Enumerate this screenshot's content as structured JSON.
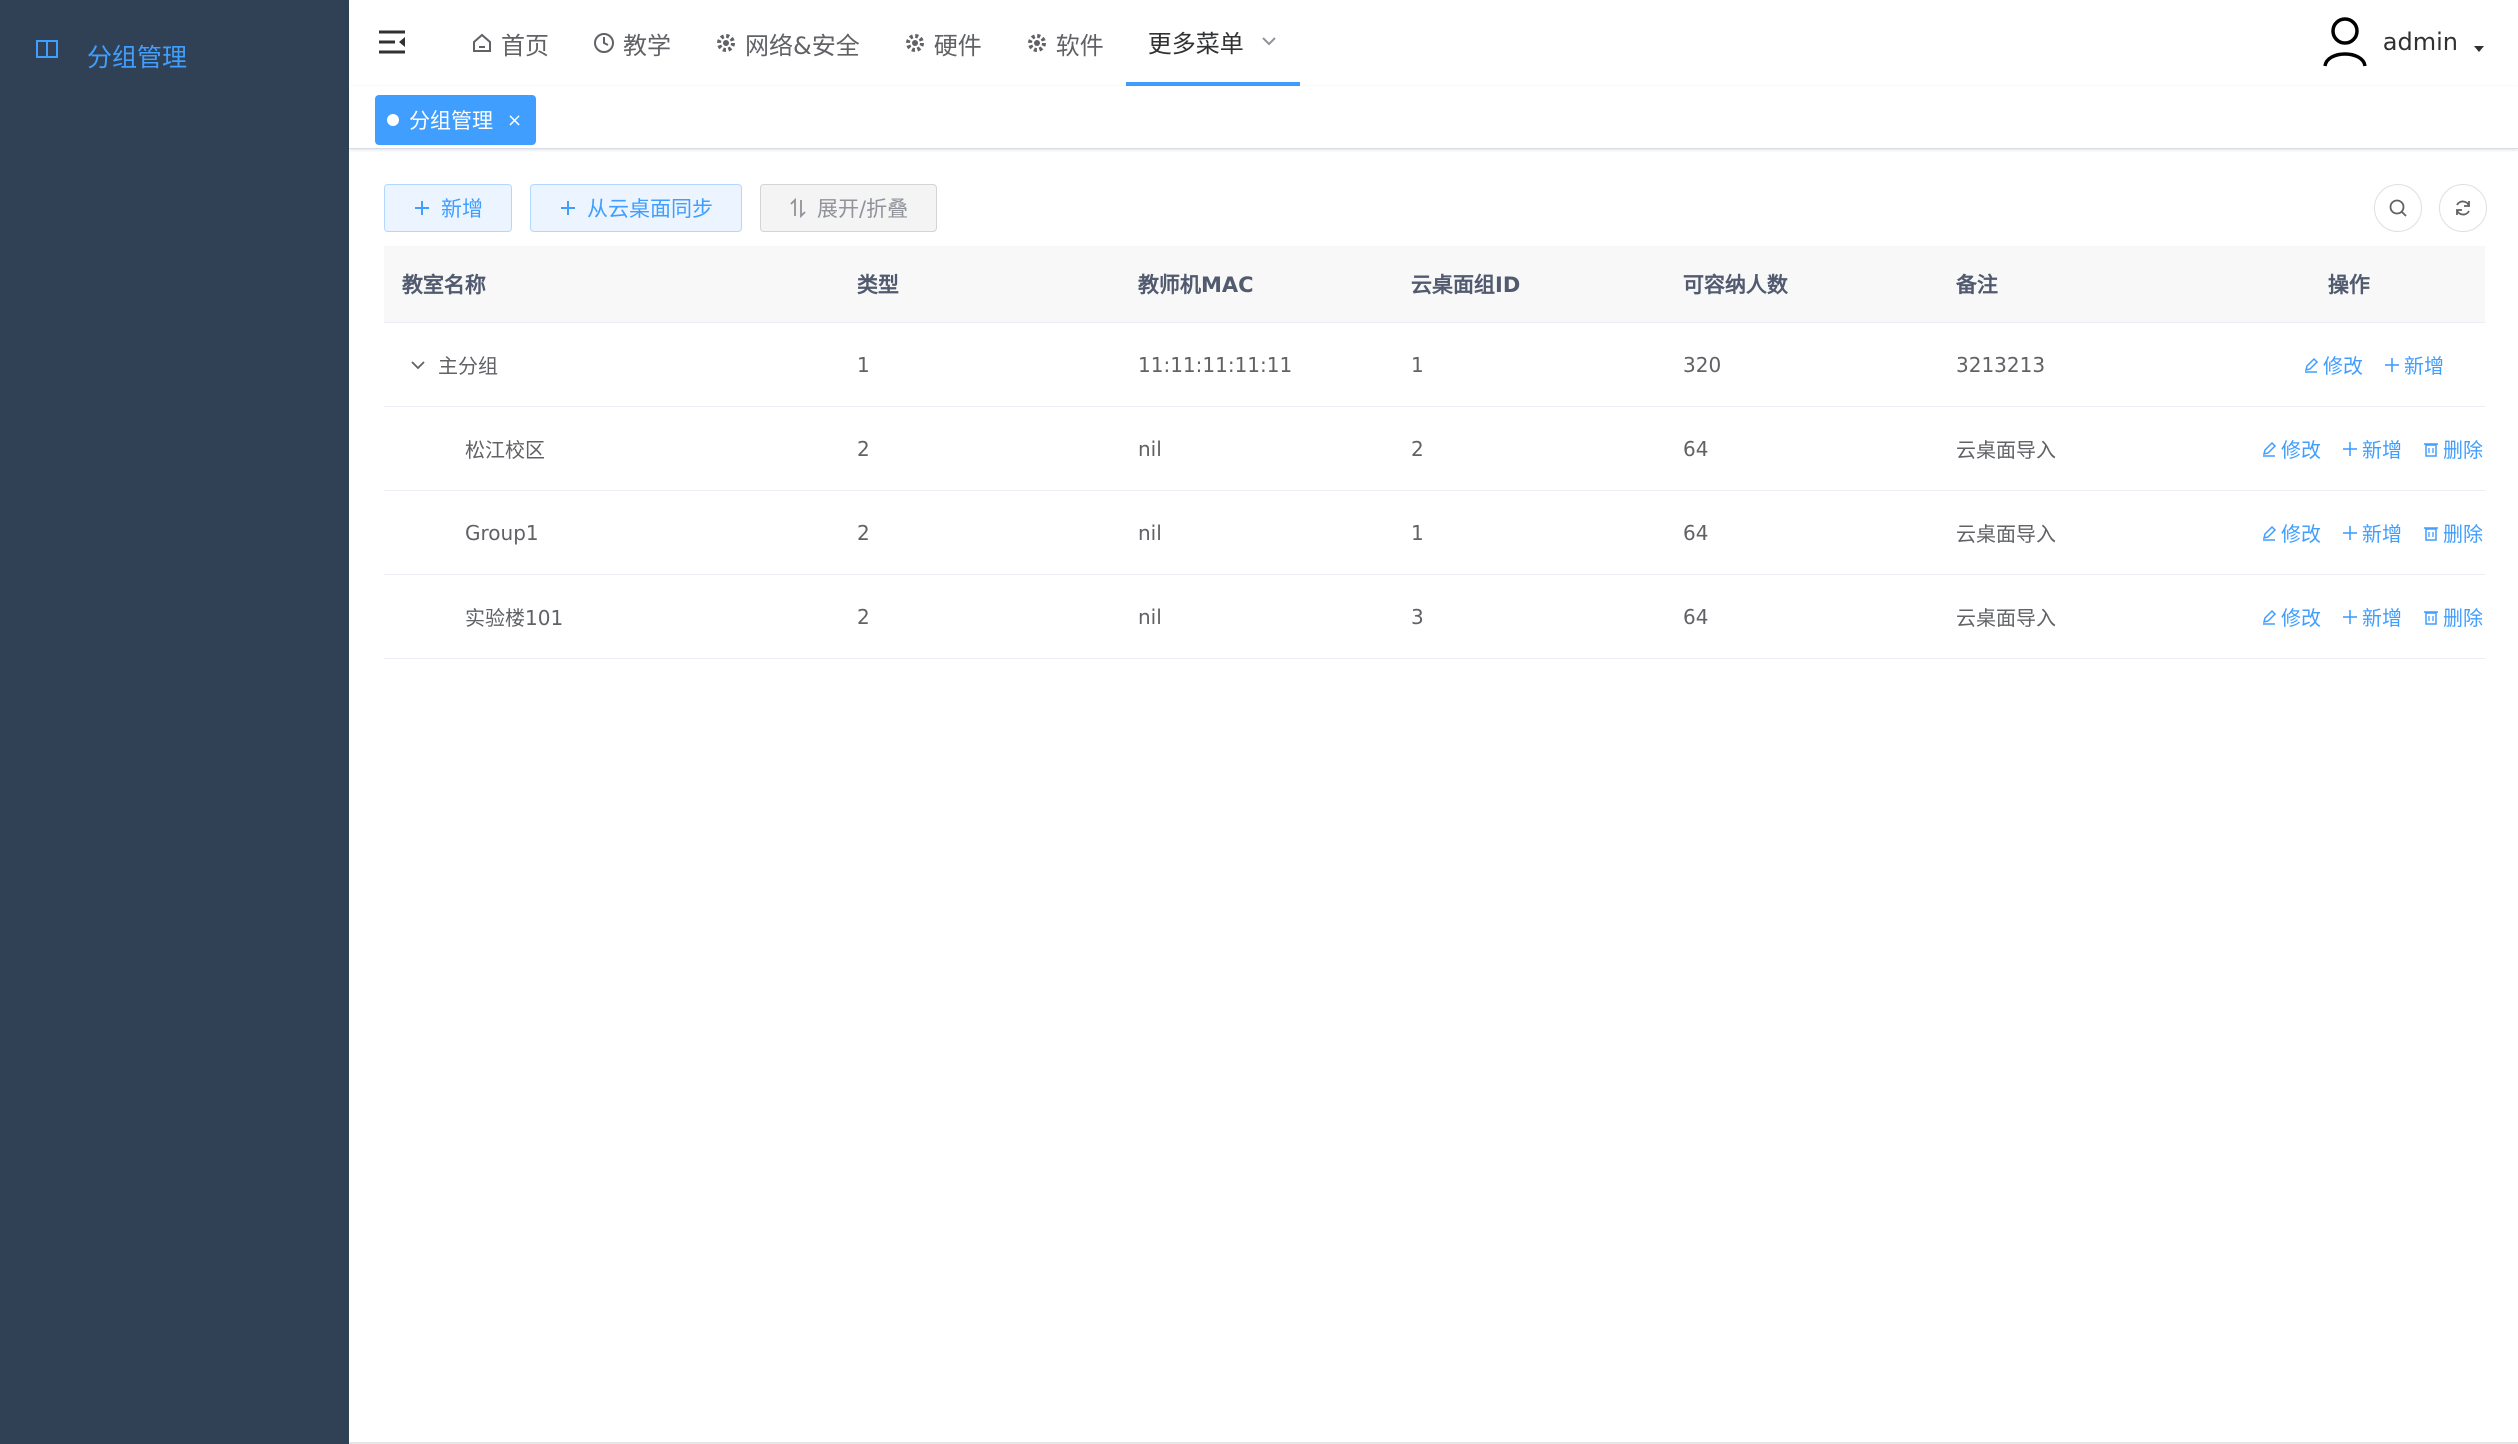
{
  "sidebar": {
    "item": {
      "label": "分组管理",
      "icon": "columns-icon"
    }
  },
  "navbar": {
    "menu": [
      {
        "label": "首页",
        "icon": "home-icon"
      },
      {
        "label": "教学",
        "icon": "clock-icon"
      },
      {
        "label": "网络&安全",
        "icon": "gear-icon"
      },
      {
        "label": "硬件",
        "icon": "gear-icon"
      },
      {
        "label": "软件",
        "icon": "gear-icon"
      },
      {
        "label": "更多菜单",
        "icon": "chevron-down-icon",
        "active": true
      }
    ],
    "user": {
      "name": "admin"
    }
  },
  "tags": [
    {
      "label": "分组管理",
      "close": "×"
    }
  ],
  "toolbar": {
    "add_label": "新增",
    "sync_label": "从云桌面同步",
    "toggle_label": "展开/折叠"
  },
  "table": {
    "headers": [
      "教室名称",
      "类型",
      "教师机MAC",
      "云桌面组ID",
      "可容纳人数",
      "备注",
      "操作"
    ],
    "rows": [
      {
        "name": "主分组",
        "type": "1",
        "mac": "11:11:11:11:11",
        "group_id": "1",
        "capacity": "320",
        "remark": "3213213",
        "expanded": true
      },
      {
        "name": "松江校区",
        "type": "2",
        "mac": "nil",
        "group_id": "2",
        "capacity": "64",
        "remark": "云桌面导入"
      },
      {
        "name": "Group1",
        "type": "2",
        "mac": "nil",
        "group_id": "1",
        "capacity": "64",
        "remark": "云桌面导入"
      },
      {
        "name": "实验楼101",
        "type": "2",
        "mac": "nil",
        "group_id": "3",
        "capacity": "64",
        "remark": "云桌面导入"
      }
    ],
    "ops": {
      "edit": "修改",
      "add": "新增",
      "delete": "删除"
    }
  },
  "colors": {
    "primary": "#409eff",
    "sidebar_bg": "#304156",
    "header_bg": "#f8f8f9"
  }
}
